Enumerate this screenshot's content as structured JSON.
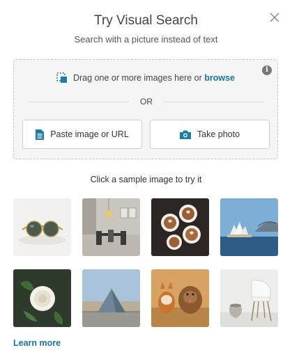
{
  "header": {
    "title": "Try Visual Search",
    "subtitle": "Search with a picture instead of text"
  },
  "dropzone": {
    "drag_text": "Drag one or more images here or ",
    "browse_label": "browse",
    "or_label": "OR",
    "paste_label": "Paste image or URL",
    "photo_label": "Take photo"
  },
  "samples": {
    "label": "Click a sample image to try it",
    "images": [
      "sunglasses",
      "dining room",
      "coffee cups",
      "sydney opera house",
      "white rose",
      "louvre pyramid",
      "dogs",
      "white chair"
    ]
  },
  "footer": {
    "learn_more": "Learn more"
  },
  "colors": {
    "accent": "#1a73a8",
    "icon": "#1a7fa8"
  }
}
